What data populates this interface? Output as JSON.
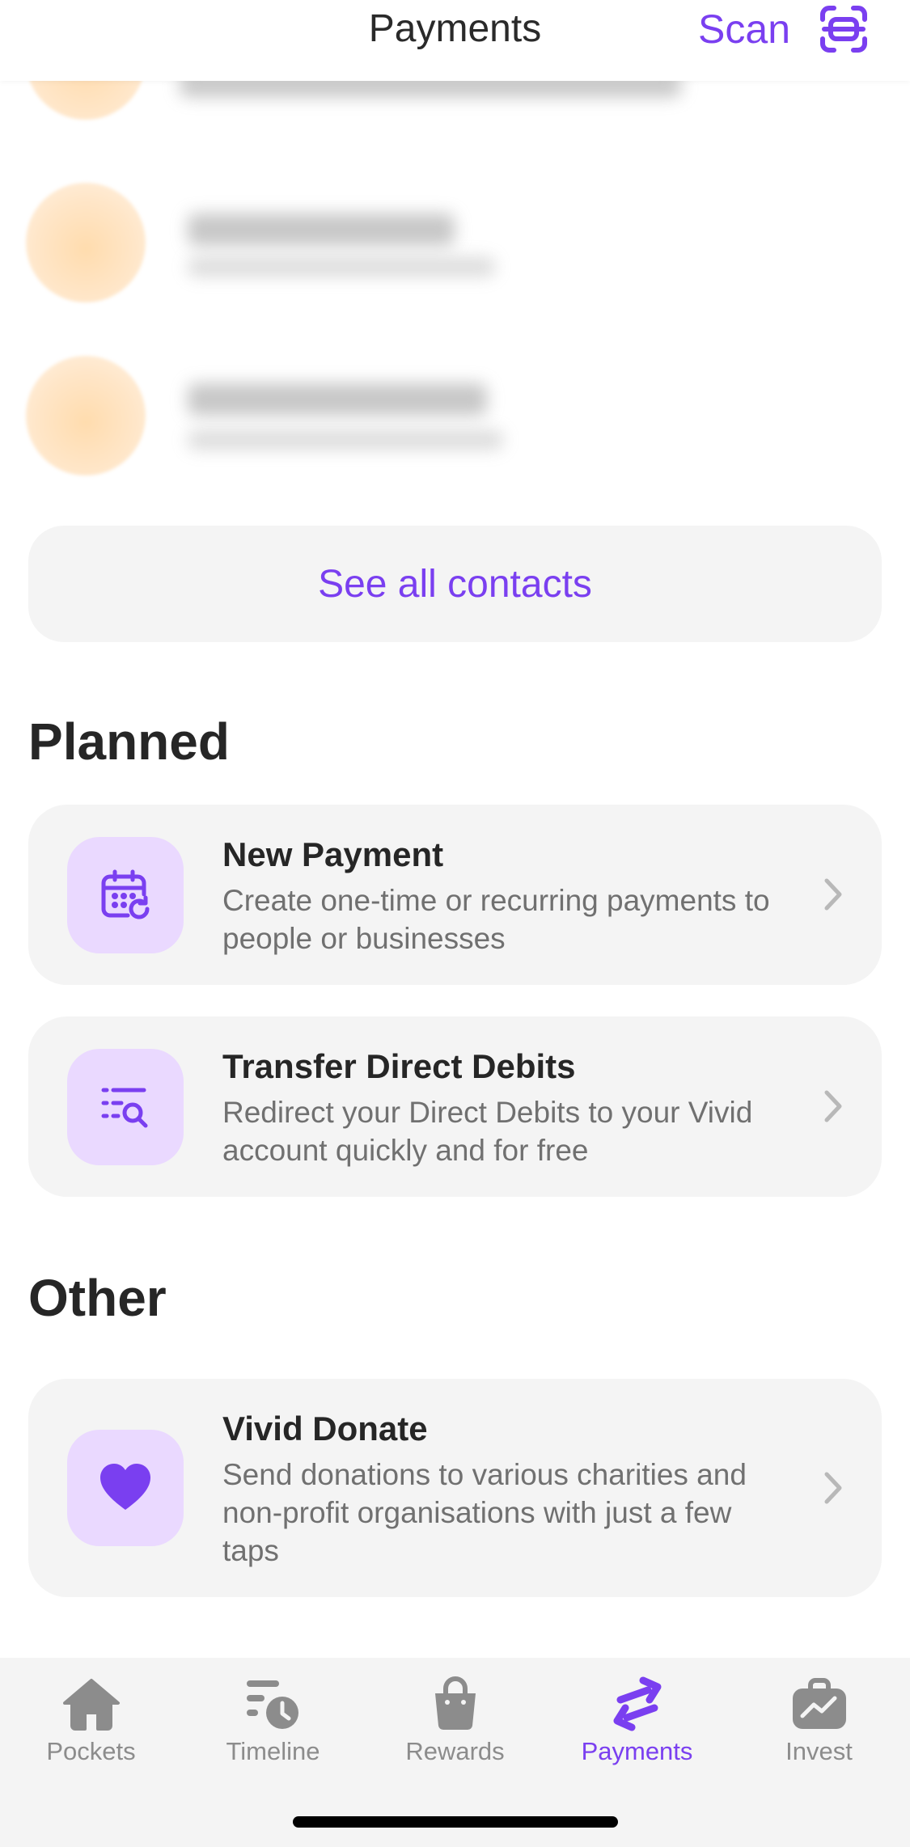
{
  "header": {
    "title": "Payments",
    "scan_label": "Scan"
  },
  "contacts": {
    "see_all_label": "See all contacts"
  },
  "planned": {
    "title": "Planned",
    "items": [
      {
        "title": "New Payment",
        "description": "Create one-time or recurring payments to people or businesses",
        "icon": "calendar-refresh-icon"
      },
      {
        "title": "Transfer Direct Debits",
        "description": "Redirect your Direct Debits to your Vivid account quickly and for free",
        "icon": "list-search-icon"
      }
    ]
  },
  "other": {
    "title": "Other",
    "items": [
      {
        "title": "Vivid Donate",
        "description": "Send donations to various charities and non-profit organisations with just a few taps",
        "icon": "heart-icon"
      }
    ]
  },
  "nav": {
    "items": [
      {
        "label": "Pockets",
        "icon": "home-icon"
      },
      {
        "label": "Timeline",
        "icon": "timeline-icon"
      },
      {
        "label": "Rewards",
        "icon": "shopping-bag-icon"
      },
      {
        "label": "Payments",
        "icon": "transfer-arrows-icon",
        "active": true
      },
      {
        "label": "Invest",
        "icon": "briefcase-icon"
      }
    ]
  },
  "colors": {
    "accent": "#7a3ff0",
    "card_bg": "#f4f4f4",
    "icon_bg": "#ead9ff"
  }
}
